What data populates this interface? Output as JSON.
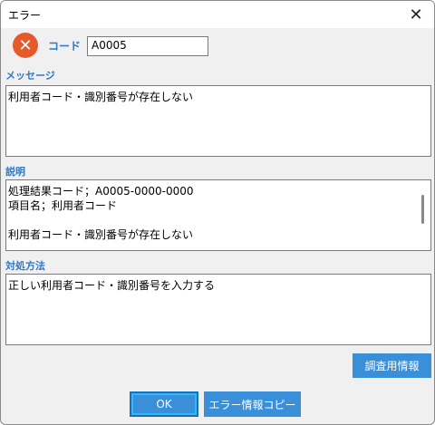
{
  "window": {
    "title": "エラー"
  },
  "code": {
    "label": "コード",
    "value": "A0005"
  },
  "message": {
    "label": "メッセージ",
    "lines": [
      "利用者コード・識別番号が存在しない"
    ]
  },
  "description": {
    "label": "説明",
    "lines": [
      "処理結果コード；A0005-0000-0000",
      "項目名；利用者コード",
      "",
      "利用者コード・識別番号が存在しない"
    ]
  },
  "remedy": {
    "label": "対処方法",
    "lines": [
      "正しい利用者コード・識別番号を入力する"
    ]
  },
  "buttons": {
    "investigate": "調査用情報",
    "ok": "OK",
    "copy": "エラー情報コピー"
  },
  "colors": {
    "accent": "#2f78c6",
    "button": "#3a8fd9",
    "error_icon": "#e55a2b"
  }
}
